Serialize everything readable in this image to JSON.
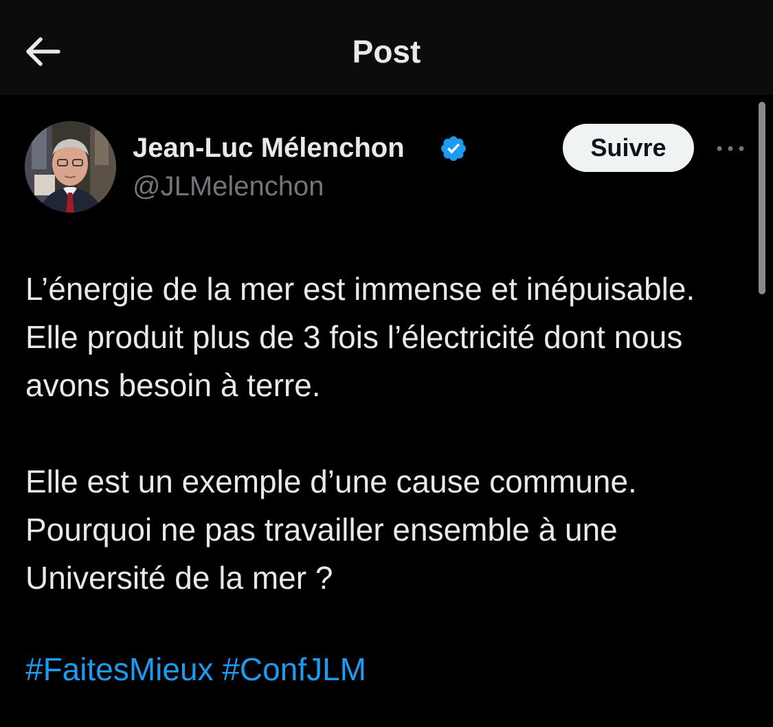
{
  "header": {
    "title": "Post",
    "back_icon": "arrow-left-icon"
  },
  "author": {
    "name": "Jean-Luc Mélenchon",
    "handle": "@JLMelenchon",
    "verified": true,
    "verified_color": "#1d9bf0",
    "avatar": "avatar-photo"
  },
  "actions": {
    "follow_label": "Suivre",
    "more_icon": "more-horizontal-icon"
  },
  "tweet": {
    "paragraph1": "L’énergie de la mer est immense et inépuisable. Elle produit plus de 3 fois l’électricité dont nous avons besoin à terre.",
    "paragraph2": "Elle est un exemple d’une cause commune. Pourquoi ne pas travailler ensemble à une Université de la mer ?",
    "hashtags": [
      "#FaitesMieux",
      "#ConfJLM"
    ]
  },
  "colors": {
    "background": "#000000",
    "header_background": "#0c0c0c",
    "text": "#e7e9ea",
    "secondary_text": "#71767b",
    "link": "#1d9bf0",
    "button_background": "#eff3f4"
  }
}
